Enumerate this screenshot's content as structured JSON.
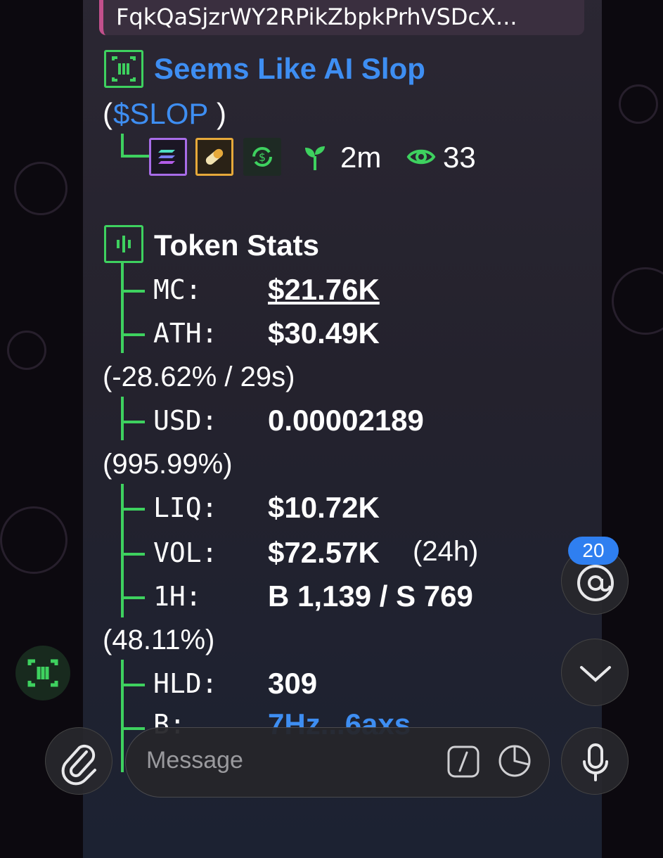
{
  "quote": {
    "text": "FqkQaSjzrWY2RPikZbpkPrhVSDcX..."
  },
  "token": {
    "name": "Seems Like AI Slop",
    "ticker_open": "(",
    "ticker": "$SLOP",
    "ticker_close": ")",
    "age": "2m",
    "views": "33"
  },
  "stats": {
    "title": "Token Stats",
    "mc_label": "MC:",
    "mc_value": "$21.76K",
    "ath_label": "ATH:",
    "ath_value": "$30.49K",
    "ath_change": "(-28.62% / 29s)",
    "usd_label": "USD:",
    "usd_value": "0.00002189",
    "usd_change": "(995.99%)",
    "liq_label": "LIQ:",
    "liq_value": "$10.72K",
    "vol_label": "VOL:",
    "vol_value": "$72.57K",
    "vol_period": "(24h)",
    "h1_label": "1H:",
    "h1_value": "B 1,139 / S 769",
    "h1_change": "(48.11%)",
    "hld_label": "HLD:",
    "hld_value": "309",
    "b_label": "B:",
    "b_value": "7Hz...6axs"
  },
  "composer": {
    "placeholder": "Message",
    "mention_count": "20"
  },
  "colors": {
    "accent_green": "#3ed15f",
    "link_blue": "#3e8ef2",
    "quote_bar": "#c2508c"
  }
}
